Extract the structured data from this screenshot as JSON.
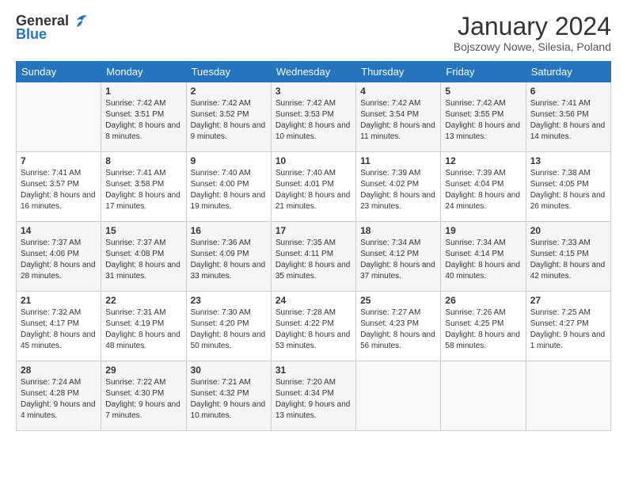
{
  "header": {
    "logo_general": "General",
    "logo_blue": "Blue",
    "month_title": "January 2024",
    "location": "Bojszowy Nowe, Silesia, Poland"
  },
  "days_of_week": [
    "Sunday",
    "Monday",
    "Tuesday",
    "Wednesday",
    "Thursday",
    "Friday",
    "Saturday"
  ],
  "weeks": [
    [
      {
        "day": "",
        "sunrise": "",
        "sunset": "",
        "daylight": ""
      },
      {
        "day": "1",
        "sunrise": "Sunrise: 7:42 AM",
        "sunset": "Sunset: 3:51 PM",
        "daylight": "Daylight: 8 hours and 8 minutes."
      },
      {
        "day": "2",
        "sunrise": "Sunrise: 7:42 AM",
        "sunset": "Sunset: 3:52 PM",
        "daylight": "Daylight: 8 hours and 9 minutes."
      },
      {
        "day": "3",
        "sunrise": "Sunrise: 7:42 AM",
        "sunset": "Sunset: 3:53 PM",
        "daylight": "Daylight: 8 hours and 10 minutes."
      },
      {
        "day": "4",
        "sunrise": "Sunrise: 7:42 AM",
        "sunset": "Sunset: 3:54 PM",
        "daylight": "Daylight: 8 hours and 11 minutes."
      },
      {
        "day": "5",
        "sunrise": "Sunrise: 7:42 AM",
        "sunset": "Sunset: 3:55 PM",
        "daylight": "Daylight: 8 hours and 13 minutes."
      },
      {
        "day": "6",
        "sunrise": "Sunrise: 7:41 AM",
        "sunset": "Sunset: 3:56 PM",
        "daylight": "Daylight: 8 hours and 14 minutes."
      }
    ],
    [
      {
        "day": "7",
        "sunrise": "Sunrise: 7:41 AM",
        "sunset": "Sunset: 3:57 PM",
        "daylight": "Daylight: 8 hours and 16 minutes."
      },
      {
        "day": "8",
        "sunrise": "Sunrise: 7:41 AM",
        "sunset": "Sunset: 3:58 PM",
        "daylight": "Daylight: 8 hours and 17 minutes."
      },
      {
        "day": "9",
        "sunrise": "Sunrise: 7:40 AM",
        "sunset": "Sunset: 4:00 PM",
        "daylight": "Daylight: 8 hours and 19 minutes."
      },
      {
        "day": "10",
        "sunrise": "Sunrise: 7:40 AM",
        "sunset": "Sunset: 4:01 PM",
        "daylight": "Daylight: 8 hours and 21 minutes."
      },
      {
        "day": "11",
        "sunrise": "Sunrise: 7:39 AM",
        "sunset": "Sunset: 4:02 PM",
        "daylight": "Daylight: 8 hours and 23 minutes."
      },
      {
        "day": "12",
        "sunrise": "Sunrise: 7:39 AM",
        "sunset": "Sunset: 4:04 PM",
        "daylight": "Daylight: 8 hours and 24 minutes."
      },
      {
        "day": "13",
        "sunrise": "Sunrise: 7:38 AM",
        "sunset": "Sunset: 4:05 PM",
        "daylight": "Daylight: 8 hours and 26 minutes."
      }
    ],
    [
      {
        "day": "14",
        "sunrise": "Sunrise: 7:37 AM",
        "sunset": "Sunset: 4:06 PM",
        "daylight": "Daylight: 8 hours and 28 minutes."
      },
      {
        "day": "15",
        "sunrise": "Sunrise: 7:37 AM",
        "sunset": "Sunset: 4:08 PM",
        "daylight": "Daylight: 8 hours and 31 minutes."
      },
      {
        "day": "16",
        "sunrise": "Sunrise: 7:36 AM",
        "sunset": "Sunset: 4:09 PM",
        "daylight": "Daylight: 8 hours and 33 minutes."
      },
      {
        "day": "17",
        "sunrise": "Sunrise: 7:35 AM",
        "sunset": "Sunset: 4:11 PM",
        "daylight": "Daylight: 8 hours and 35 minutes."
      },
      {
        "day": "18",
        "sunrise": "Sunrise: 7:34 AM",
        "sunset": "Sunset: 4:12 PM",
        "daylight": "Daylight: 8 hours and 37 minutes."
      },
      {
        "day": "19",
        "sunrise": "Sunrise: 7:34 AM",
        "sunset": "Sunset: 4:14 PM",
        "daylight": "Daylight: 8 hours and 40 minutes."
      },
      {
        "day": "20",
        "sunrise": "Sunrise: 7:33 AM",
        "sunset": "Sunset: 4:15 PM",
        "daylight": "Daylight: 8 hours and 42 minutes."
      }
    ],
    [
      {
        "day": "21",
        "sunrise": "Sunrise: 7:32 AM",
        "sunset": "Sunset: 4:17 PM",
        "daylight": "Daylight: 8 hours and 45 minutes."
      },
      {
        "day": "22",
        "sunrise": "Sunrise: 7:31 AM",
        "sunset": "Sunset: 4:19 PM",
        "daylight": "Daylight: 8 hours and 48 minutes."
      },
      {
        "day": "23",
        "sunrise": "Sunrise: 7:30 AM",
        "sunset": "Sunset: 4:20 PM",
        "daylight": "Daylight: 8 hours and 50 minutes."
      },
      {
        "day": "24",
        "sunrise": "Sunrise: 7:28 AM",
        "sunset": "Sunset: 4:22 PM",
        "daylight": "Daylight: 8 hours and 53 minutes."
      },
      {
        "day": "25",
        "sunrise": "Sunrise: 7:27 AM",
        "sunset": "Sunset: 4:23 PM",
        "daylight": "Daylight: 8 hours and 56 minutes."
      },
      {
        "day": "26",
        "sunrise": "Sunrise: 7:26 AM",
        "sunset": "Sunset: 4:25 PM",
        "daylight": "Daylight: 8 hours and 58 minutes."
      },
      {
        "day": "27",
        "sunrise": "Sunrise: 7:25 AM",
        "sunset": "Sunset: 4:27 PM",
        "daylight": "Daylight: 9 hours and 1 minute."
      }
    ],
    [
      {
        "day": "28",
        "sunrise": "Sunrise: 7:24 AM",
        "sunset": "Sunset: 4:28 PM",
        "daylight": "Daylight: 9 hours and 4 minutes."
      },
      {
        "day": "29",
        "sunrise": "Sunrise: 7:22 AM",
        "sunset": "Sunset: 4:30 PM",
        "daylight": "Daylight: 9 hours and 7 minutes."
      },
      {
        "day": "30",
        "sunrise": "Sunrise: 7:21 AM",
        "sunset": "Sunset: 4:32 PM",
        "daylight": "Daylight: 9 hours and 10 minutes."
      },
      {
        "day": "31",
        "sunrise": "Sunrise: 7:20 AM",
        "sunset": "Sunset: 4:34 PM",
        "daylight": "Daylight: 9 hours and 13 minutes."
      },
      {
        "day": "",
        "sunrise": "",
        "sunset": "",
        "daylight": ""
      },
      {
        "day": "",
        "sunrise": "",
        "sunset": "",
        "daylight": ""
      },
      {
        "day": "",
        "sunrise": "",
        "sunset": "",
        "daylight": ""
      }
    ]
  ]
}
